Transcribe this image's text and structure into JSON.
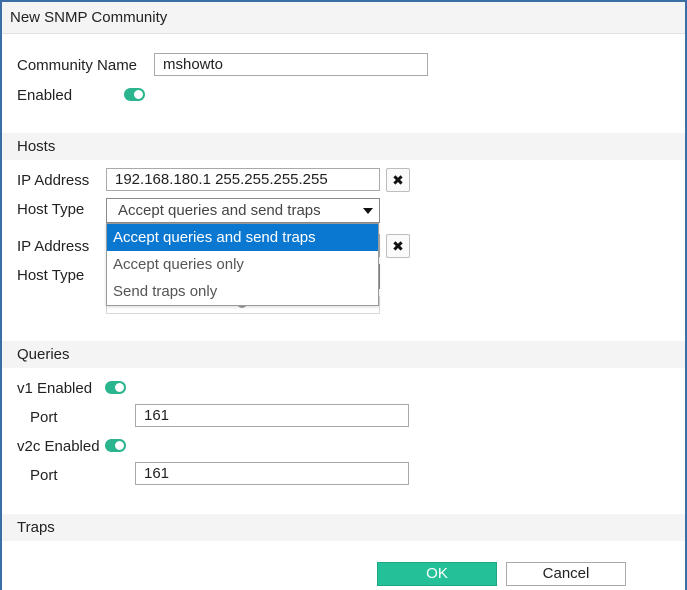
{
  "dialog": {
    "title": "New SNMP Community"
  },
  "community": {
    "name_label": "Community Name",
    "name_value": "mshowto",
    "enabled_label": "Enabled",
    "enabled": true
  },
  "hosts": {
    "section_label": "Hosts",
    "rows": [
      {
        "ip_label": "IP Address",
        "ip_value": "192.168.180.1 255.255.255.255",
        "type_label": "Host Type",
        "type_value": "Accept queries and send traps"
      },
      {
        "ip_label": "IP Address",
        "type_label": "Host Type"
      }
    ],
    "dropdown_options": [
      "Accept queries and send traps",
      "Accept queries only",
      "Send traps only"
    ],
    "dropdown_selected": "Accept queries and send traps"
  },
  "queries": {
    "section_label": "Queries",
    "v1_label": "v1 Enabled",
    "v1_enabled": true,
    "v1_port_label": "Port",
    "v1_port": "161",
    "v2c_label": "v2c Enabled",
    "v2c_enabled": true,
    "v2c_port_label": "Port",
    "v2c_port": "161"
  },
  "traps": {
    "section_label": "Traps"
  },
  "buttons": {
    "ok_label": "OK",
    "cancel_label": "Cancel"
  },
  "icons": {
    "remove": "close-icon",
    "dropdown": "caret-down-icon"
  },
  "colors": {
    "accent": "#24c199",
    "toggle_on": "#2bb58f",
    "selection": "#0a78d0",
    "frame": "#3b6ea5"
  }
}
